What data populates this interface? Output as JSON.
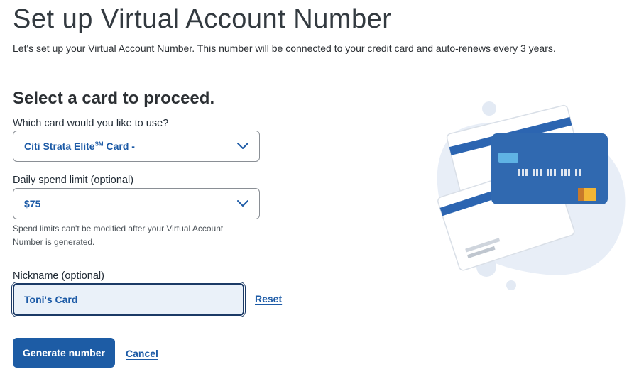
{
  "header": {
    "title": "Set up Virtual Account Number",
    "intro": "Let's set up your Virtual Account Number. This number will be connected to your credit card and auto-renews every 3 years."
  },
  "form": {
    "section_title": "Select a card to proceed.",
    "card_select": {
      "label": "Which card would you like to use?",
      "value_main": "Citi Strata Elite",
      "value_sup": "SM",
      "value_suffix": " Card -"
    },
    "limit_select": {
      "label": "Daily spend limit (optional)",
      "value": "$75",
      "helper": "Spend limits can't be modified after your Virtual Account Number is generated."
    },
    "nickname": {
      "label": "Nickname (optional)",
      "value": "Toni's Card",
      "reset_label": "Reset"
    },
    "actions": {
      "generate_label": "Generate number",
      "cancel_label": "Cancel"
    }
  },
  "colors": {
    "brand_blue": "#1d5ca5",
    "link_blue": "#1c5aa6",
    "focus_border": "#1b3a66",
    "input_bg": "#eaf1f9"
  },
  "icons": {
    "select_chevron": "chevron-down-icon",
    "illustration": "credit-cards-illustration"
  }
}
